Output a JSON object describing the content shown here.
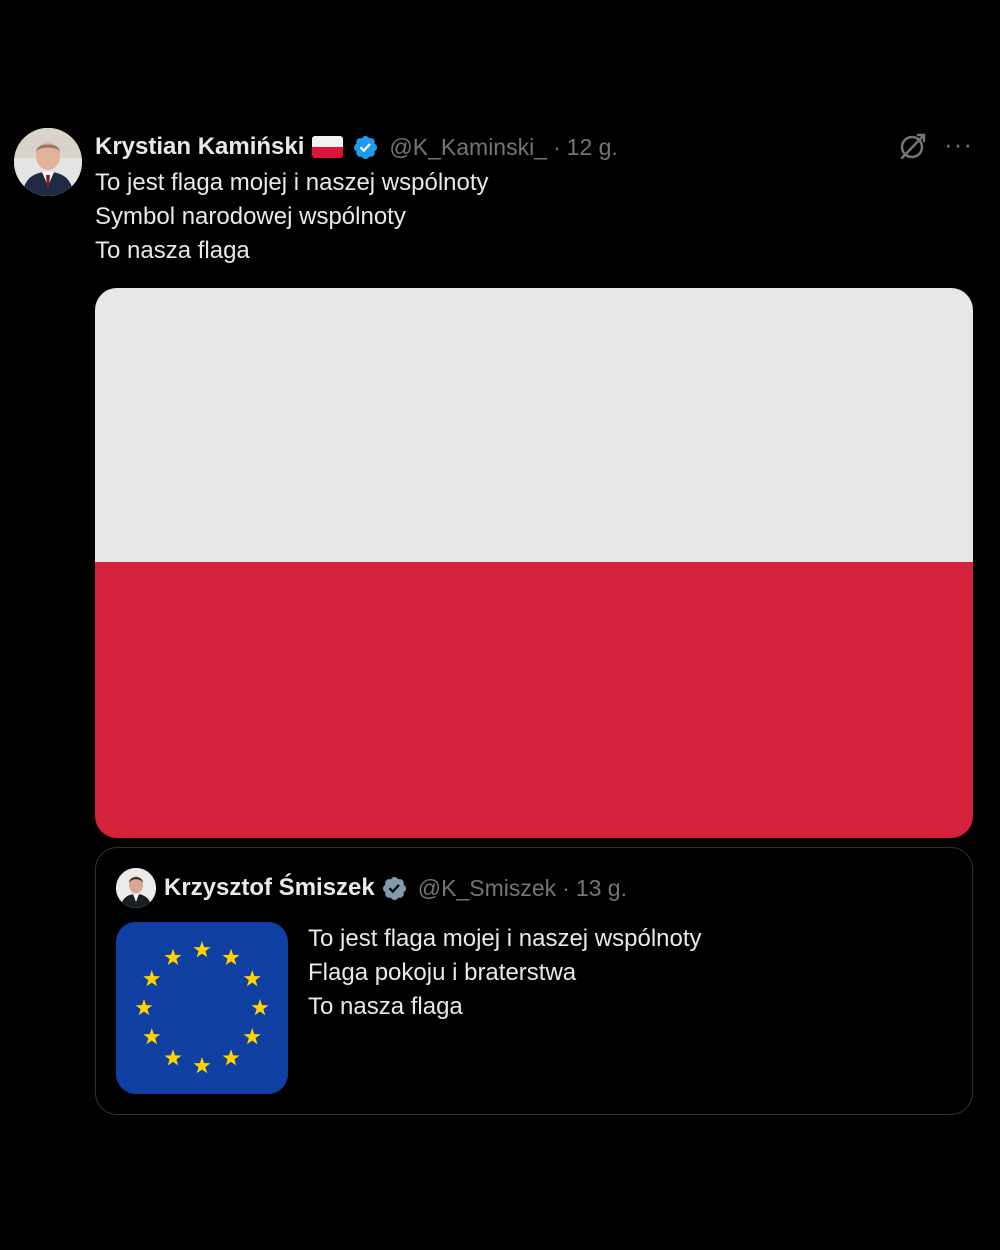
{
  "tweet": {
    "author_name": "Krystian Kamiński",
    "author_flag_icon": "poland-flag-emoji",
    "verified_icon": "verified-badge-icon",
    "handle": "@K_Kaminski_",
    "separator": "·",
    "time": "12 g.",
    "lines": [
      "To jest flaga mojej i naszej wspólnoty",
      "Symbol narodowej wspólnoty",
      "To nasza flaga"
    ],
    "media_icon": "poland-flag-image",
    "colors": {
      "flag_white": "#e8e7e5",
      "flag_red": "#d4223d",
      "verified_blue": "#1d9bf0"
    }
  },
  "quote": {
    "author_name": "Krzysztof Śmiszek",
    "verified_icon": "verified-badge-icon",
    "handle": "@K_Smiszek",
    "separator": "·",
    "time": "13 g.",
    "lines": [
      "To jest flaga mojej i naszej wspólnoty",
      "Flaga pokoju i braterstwa",
      "To nasza flaga"
    ],
    "media_icon": "eu-flag-image",
    "colors": {
      "eu_blue": "#0e3fa1",
      "eu_star": "#ffd200",
      "verified_gray": "#829aab"
    }
  },
  "actions": {
    "grok_icon": "grok-icon",
    "more_icon": "more-options-icon",
    "more_glyph": "···"
  }
}
